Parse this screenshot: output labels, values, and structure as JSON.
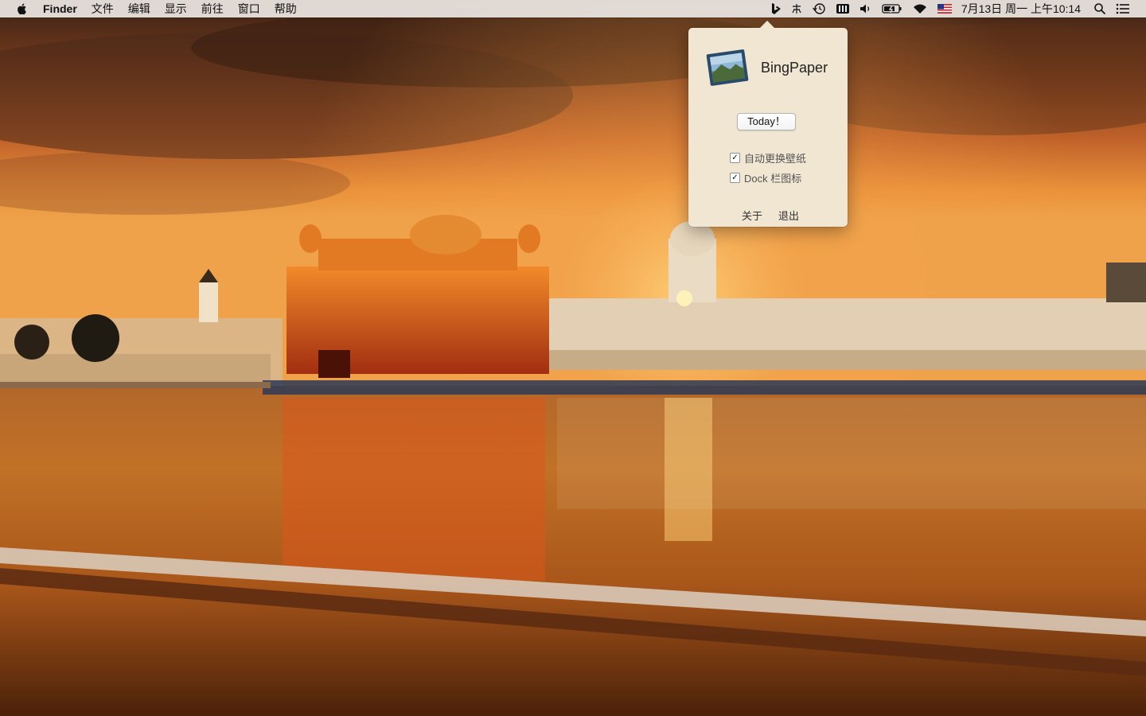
{
  "menubar": {
    "apple_icon": "apple-icon",
    "app_name": "Finder",
    "menus": [
      "文件",
      "编辑",
      "显示",
      "前往",
      "窗口",
      "帮助"
    ],
    "status_icons": [
      "bingpaper-icon",
      "input-method-icon",
      "time-machine-icon",
      "battery-status-icon",
      "volume-icon",
      "battery-icon",
      "wifi-icon",
      "us-flag-icon"
    ],
    "clock": "7月13日 周一 上午10:14",
    "search_icon": "spotlight-icon",
    "notification_icon": "notification-center-icon"
  },
  "popover": {
    "app_name": "BingPaper",
    "today_button": "Today！",
    "options": [
      {
        "label": "自动更换壁纸",
        "checked": true
      },
      {
        "label": "Dock 栏图标",
        "checked": true
      }
    ],
    "about_link": "关于",
    "quit_link": "退出"
  },
  "colors": {
    "sky_top": "#3c2416",
    "sky_glow": "#e98a2c",
    "water": "#8a4410",
    "popover_bg": "#f1e6d2"
  }
}
